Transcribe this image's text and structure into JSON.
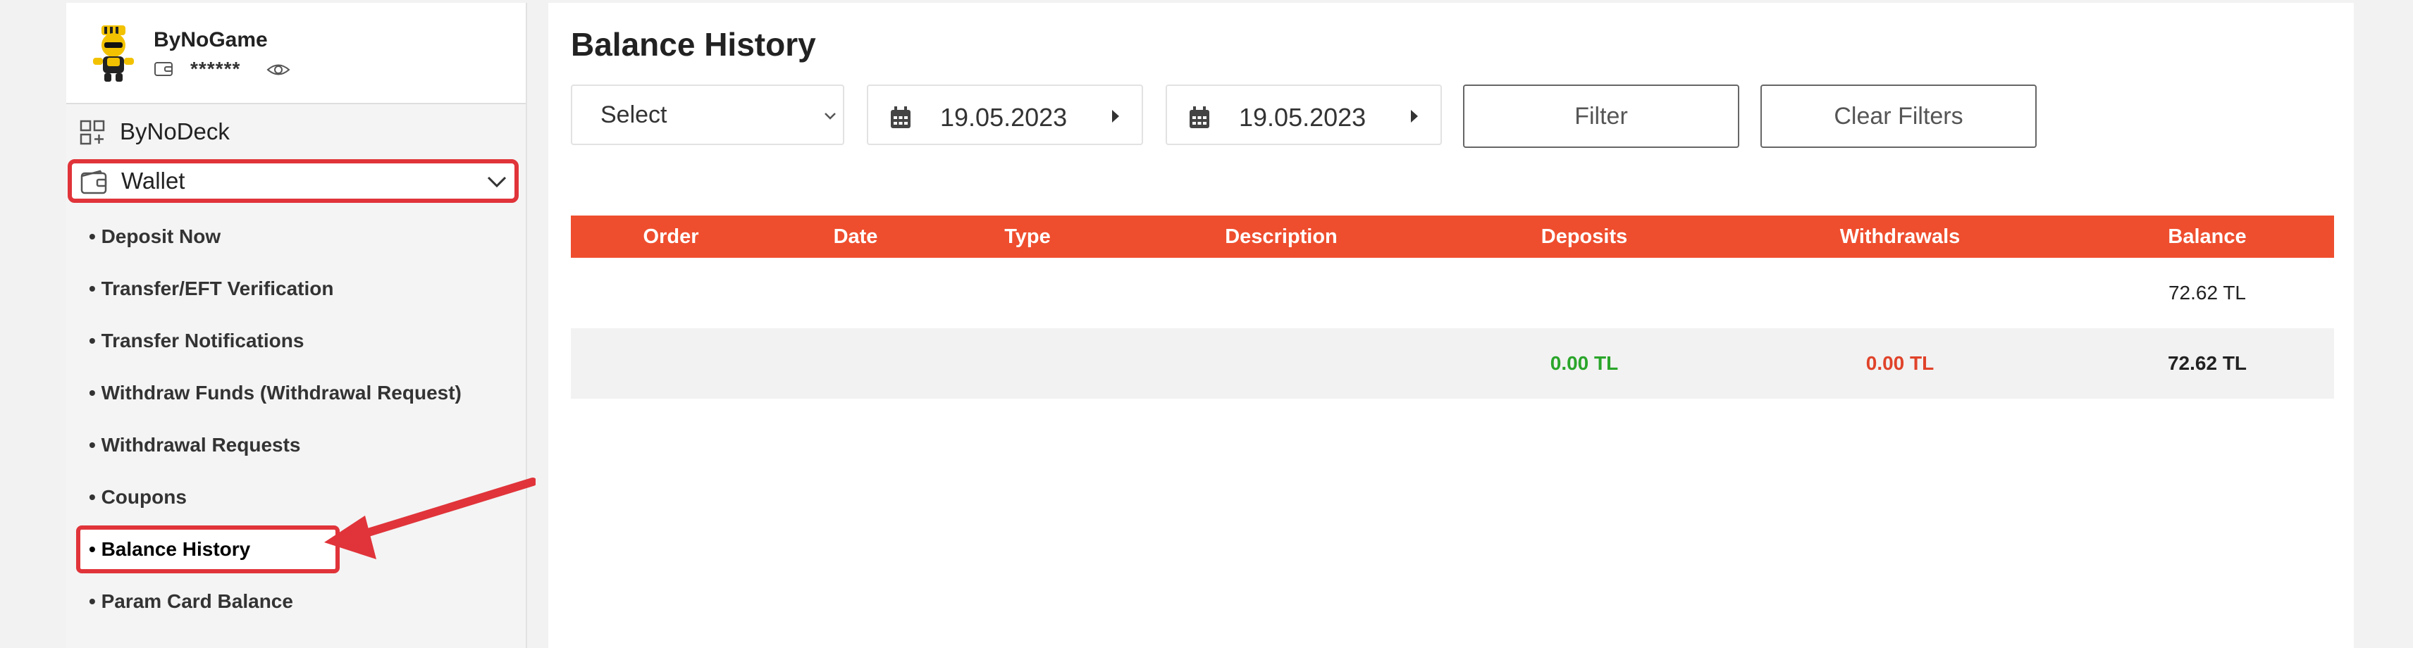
{
  "profile": {
    "name": "ByNoGame",
    "masked_balance": "******"
  },
  "sidebar": {
    "top_items": [
      {
        "label": "ByNoDeck",
        "icon": "grid-plus-icon"
      },
      {
        "label": "Wallet",
        "icon": "wallet-icon"
      }
    ],
    "wallet_submenu": [
      "• Deposit Now",
      "• Transfer/EFT Verification",
      "• Transfer Notifications",
      "• Withdraw Funds (Withdrawal Request)",
      "• Withdrawal Requests",
      "• Coupons",
      "• Balance History",
      "• Param Card Balance"
    ],
    "active_item": "• Balance History"
  },
  "main": {
    "title": "Balance History",
    "filters": {
      "select_value": "Select",
      "start_date": "19.05.2023",
      "end_date": "19.05.2023",
      "filter_label": "Filter",
      "clear_label": "Clear Filters"
    },
    "table": {
      "headers": [
        "Order",
        "Date",
        "Type",
        "Description",
        "Deposits",
        "Withdrawals",
        "Balance"
      ],
      "rows": [
        {
          "balance": "72.62 TL"
        }
      ],
      "totals": {
        "deposits": "0.00 TL",
        "withdrawals": "0.00 TL",
        "balance": "72.62 TL"
      }
    }
  },
  "colors": {
    "accent": "#ee4e2e",
    "highlight": "#e0343a",
    "deposit": "#2aa52a",
    "withdrawal": "#e0432a"
  }
}
